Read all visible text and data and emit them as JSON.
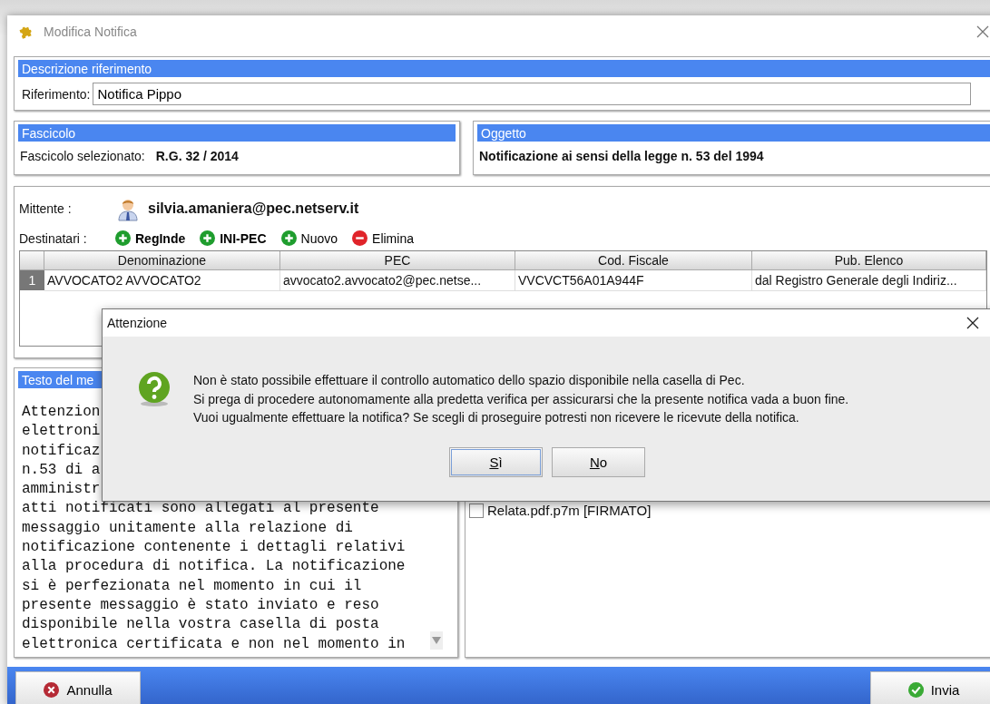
{
  "window": {
    "title": "Modifica Notifica"
  },
  "reference": {
    "header": "Descrizione riferimento",
    "label": "Riferimento:",
    "value": "Notifica Pippo"
  },
  "fascicolo": {
    "header": "Fascicolo",
    "label": "Fascicolo selezionato:",
    "value": "R.G. 32 / 2014"
  },
  "oggetto": {
    "header": "Oggetto",
    "value": "Notificazione ai sensi della legge n. 53 del 1994"
  },
  "sender": {
    "label": "Mittente :",
    "email": "silvia.amaniera@pec.netserv.it"
  },
  "recipients": {
    "label": "Destinatari :",
    "actions": [
      {
        "label": "RegInde",
        "kind": "add",
        "bold": true
      },
      {
        "label": "INI-PEC",
        "kind": "add",
        "bold": true
      },
      {
        "label": "Nuovo",
        "kind": "add",
        "bold": false
      },
      {
        "label": "Elimina",
        "kind": "remove",
        "bold": false
      }
    ],
    "columns": [
      "Denominazione",
      "PEC",
      "Cod. Fiscale",
      "Pub. Elenco"
    ],
    "rows": [
      {
        "index": "1",
        "cells": [
          "AVVOCATO2 AVVOCATO2",
          "avvocato2.avvocato2@pec.netse...",
          "VVCVCT56A01A944F",
          "dal Registro Generale degli Indiriz..."
        ]
      }
    ]
  },
  "message": {
    "header": "Testo del me",
    "lines": [
      "Attenzion",
      "elettroni",
      "notificaz",
      "n.53 di a",
      "amministr",
      "atti notificati sono allegati al presente",
      "messaggio unitamente alla relazione di",
      "notificazione contenente i dettagli relativi",
      "alla procedura di notifica. La notificazione",
      "si è perfezionata nel momento in cui il",
      "presente messaggio è stato inviato e reso",
      "disponibile nella vostra casella di posta",
      "elettronica certificata e non nel momento in"
    ]
  },
  "attachments": [
    {
      "label": "Relata.pdf.p7m [FIRMATO]",
      "checked": false
    }
  ],
  "footer": {
    "cancel": "Annulla",
    "send": "Invia"
  },
  "dialog": {
    "title": "Attenzione",
    "lines": [
      "Non è stato possibile effettuare il controllo automatico dello spazio disponibile nella casella di Pec.",
      "Si prega di procedere autonomamente alla predetta verifica per assicurarsi che la presente notifica vada a buon fine.",
      "Vuoi ugualmente effettuare la notifica? Se scegli di proseguire potresti non ricevere le ricevute della notifica."
    ],
    "buttons": [
      {
        "mnemonic": "S",
        "rest": "ì",
        "focused": true
      },
      {
        "mnemonic": "N",
        "rest": "o",
        "focused": false
      }
    ]
  }
}
